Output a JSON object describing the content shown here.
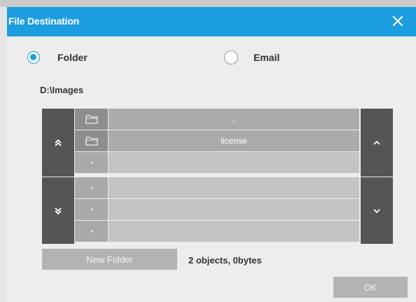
{
  "window": {
    "title": "File Destination"
  },
  "colors": {
    "accent": "#1c9de0",
    "side_buttons": "#555555"
  },
  "destination": {
    "options": [
      {
        "label": "Folder",
        "selected": true
      },
      {
        "label": "Email",
        "selected": false
      }
    ]
  },
  "path": "D:\\Images",
  "file_list": {
    "rows": [
      {
        "name": "..",
        "icon": "folder-icon",
        "empty": false
      },
      {
        "name": "license",
        "icon": "folder-icon",
        "empty": false
      },
      {
        "name": "...",
        "icon": "dot-icon",
        "empty": true
      },
      {
        "name": "...",
        "icon": "dot-icon",
        "empty": true
      },
      {
        "name": "...",
        "icon": "dot-icon",
        "empty": true
      },
      {
        "name": "...",
        "icon": "dot-icon",
        "empty": true
      }
    ],
    "icons": {
      "page_up": "double-chevron-up-icon",
      "page_down": "double-chevron-down-icon",
      "scroll_up": "chevron-up-icon",
      "scroll_down": "chevron-down-icon"
    }
  },
  "new_folder_label": "New Folder",
  "status": "2 objects, 0bytes",
  "ok_label": "OK"
}
